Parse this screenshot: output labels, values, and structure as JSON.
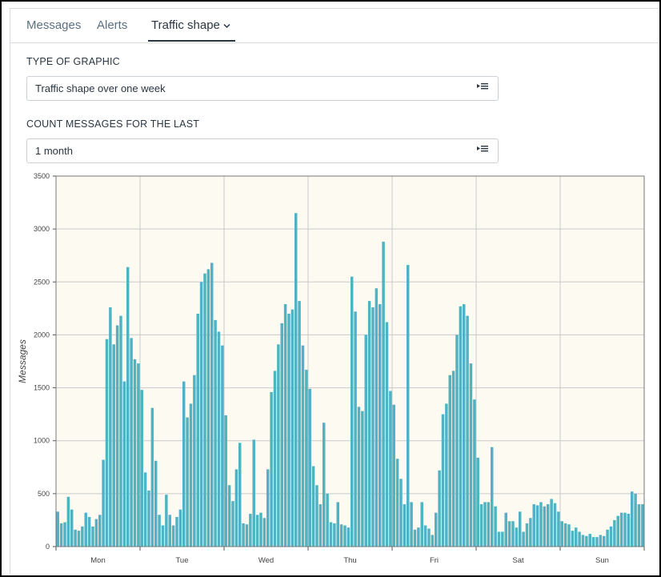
{
  "tabs": [
    {
      "label": "Messages"
    },
    {
      "label": "Alerts"
    },
    {
      "label": "Traffic shape"
    }
  ],
  "graphic_type": {
    "label": "TYPE OF GRAPHIC",
    "value": "Traffic shape over one week"
  },
  "count_period": {
    "label": "COUNT MESSAGES FOR THE LAST",
    "value": "1 month"
  },
  "colors": {
    "bar": "#4fb3c4",
    "plot_bg": "#fdfaf2",
    "grid": "#c9c9c9"
  },
  "chart_data": {
    "type": "bar",
    "title": "",
    "xlabel": "",
    "ylabel": "Messages",
    "ylim": [
      0,
      3500
    ],
    "yticks": [
      0,
      500,
      1000,
      1500,
      2000,
      2500,
      3000,
      3500
    ],
    "grid": true,
    "categories": [
      "Mon",
      "Tue",
      "Wed",
      "Thu",
      "Fri",
      "Sat",
      "Sun"
    ],
    "bars_per_category": 24,
    "values": [
      330,
      220,
      230,
      470,
      350,
      160,
      150,
      190,
      320,
      280,
      190,
      260,
      300,
      820,
      1960,
      2260,
      1910,
      2090,
      2180,
      1560,
      2640,
      1970,
      1770,
      1730,
      1480,
      700,
      530,
      1310,
      810,
      300,
      200,
      490,
      300,
      200,
      280,
      350,
      1560,
      1220,
      1350,
      1620,
      2200,
      2500,
      2580,
      2620,
      2680,
      2140,
      2030,
      1900,
      1240,
      580,
      430,
      730,
      980,
      220,
      210,
      310,
      1010,
      300,
      320,
      270,
      730,
      1460,
      1660,
      1910,
      2110,
      2290,
      2200,
      2240,
      3150,
      2320,
      1900,
      1670,
      1490,
      760,
      580,
      400,
      1170,
      500,
      230,
      220,
      420,
      210,
      200,
      180,
      2550,
      2220,
      1320,
      1280,
      2000,
      2320,
      2260,
      2440,
      2290,
      2880,
      2120,
      1470,
      1340,
      830,
      640,
      400,
      2660,
      420,
      160,
      180,
      420,
      200,
      170,
      110,
      320,
      720,
      1250,
      1350,
      1620,
      1660,
      2000,
      2270,
      2290,
      2180,
      1730,
      1390,
      840,
      400,
      420,
      420,
      940,
      380,
      140,
      140,
      320,
      240,
      240,
      180,
      330,
      140,
      220,
      270,
      400,
      390,
      420,
      380,
      400,
      450,
      410,
      330,
      240,
      220,
      210,
      150,
      180,
      140,
      110,
      100,
      120,
      90,
      90,
      110,
      100,
      160,
      190,
      250,
      290,
      320,
      320,
      310,
      520,
      500,
      400,
      400
    ]
  }
}
